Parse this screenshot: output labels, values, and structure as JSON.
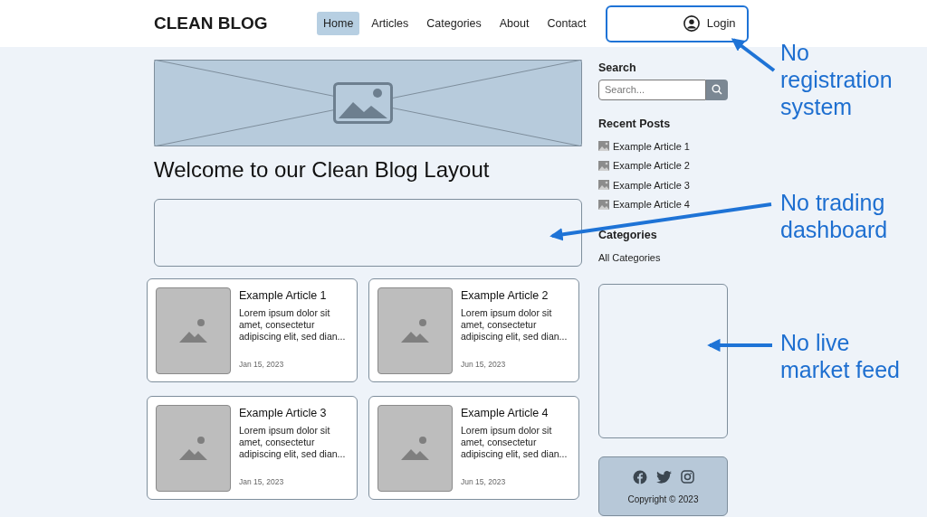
{
  "header": {
    "logo": "CLEAN BLOG",
    "nav": [
      {
        "label": "Home",
        "selected": true
      },
      {
        "label": "Articles",
        "selected": false
      },
      {
        "label": "Categories",
        "selected": false
      },
      {
        "label": "About",
        "selected": false
      },
      {
        "label": "Contact",
        "selected": false
      }
    ],
    "login": "Login"
  },
  "main": {
    "title": "Welcome to our Clean Blog Layout",
    "articles": [
      {
        "title": "Example Article 1",
        "excerpt": "Lorem ipsum dolor sit amet, consectetur adipiscing elit, sed dian...",
        "date": "Jan 15, 2023"
      },
      {
        "title": "Example Article 2",
        "excerpt": "Lorem ipsum dolor sit amet, consectetur adipiscing elit, sed dian...",
        "date": "Jun 15, 2023"
      },
      {
        "title": "Example Article 3",
        "excerpt": "Lorem ipsum dolor sit amet, consectetur adipiscing elit, sed dian...",
        "date": "Jan 15, 2023"
      },
      {
        "title": "Example Article 4",
        "excerpt": "Lorem ipsum dolor sit amet, consectetur adipiscing elit, sed dian...",
        "date": "Jun 15, 2023"
      }
    ]
  },
  "sidebar": {
    "search": {
      "heading": "Search",
      "placeholder": "Search..."
    },
    "recent_posts": {
      "heading": "Recent Posts",
      "items": [
        "Example Article 1",
        "Example Article 2",
        "Example Article 3",
        "Example Article 4"
      ]
    },
    "categories": {
      "heading": "Categories",
      "items": [
        "All Categories"
      ]
    },
    "footer": {
      "copyright": "Copyright © 2023"
    }
  },
  "annotations": [
    {
      "text": "No registration system"
    },
    {
      "text": "No trading dashboard"
    },
    {
      "text": "No live market feed"
    }
  ]
}
